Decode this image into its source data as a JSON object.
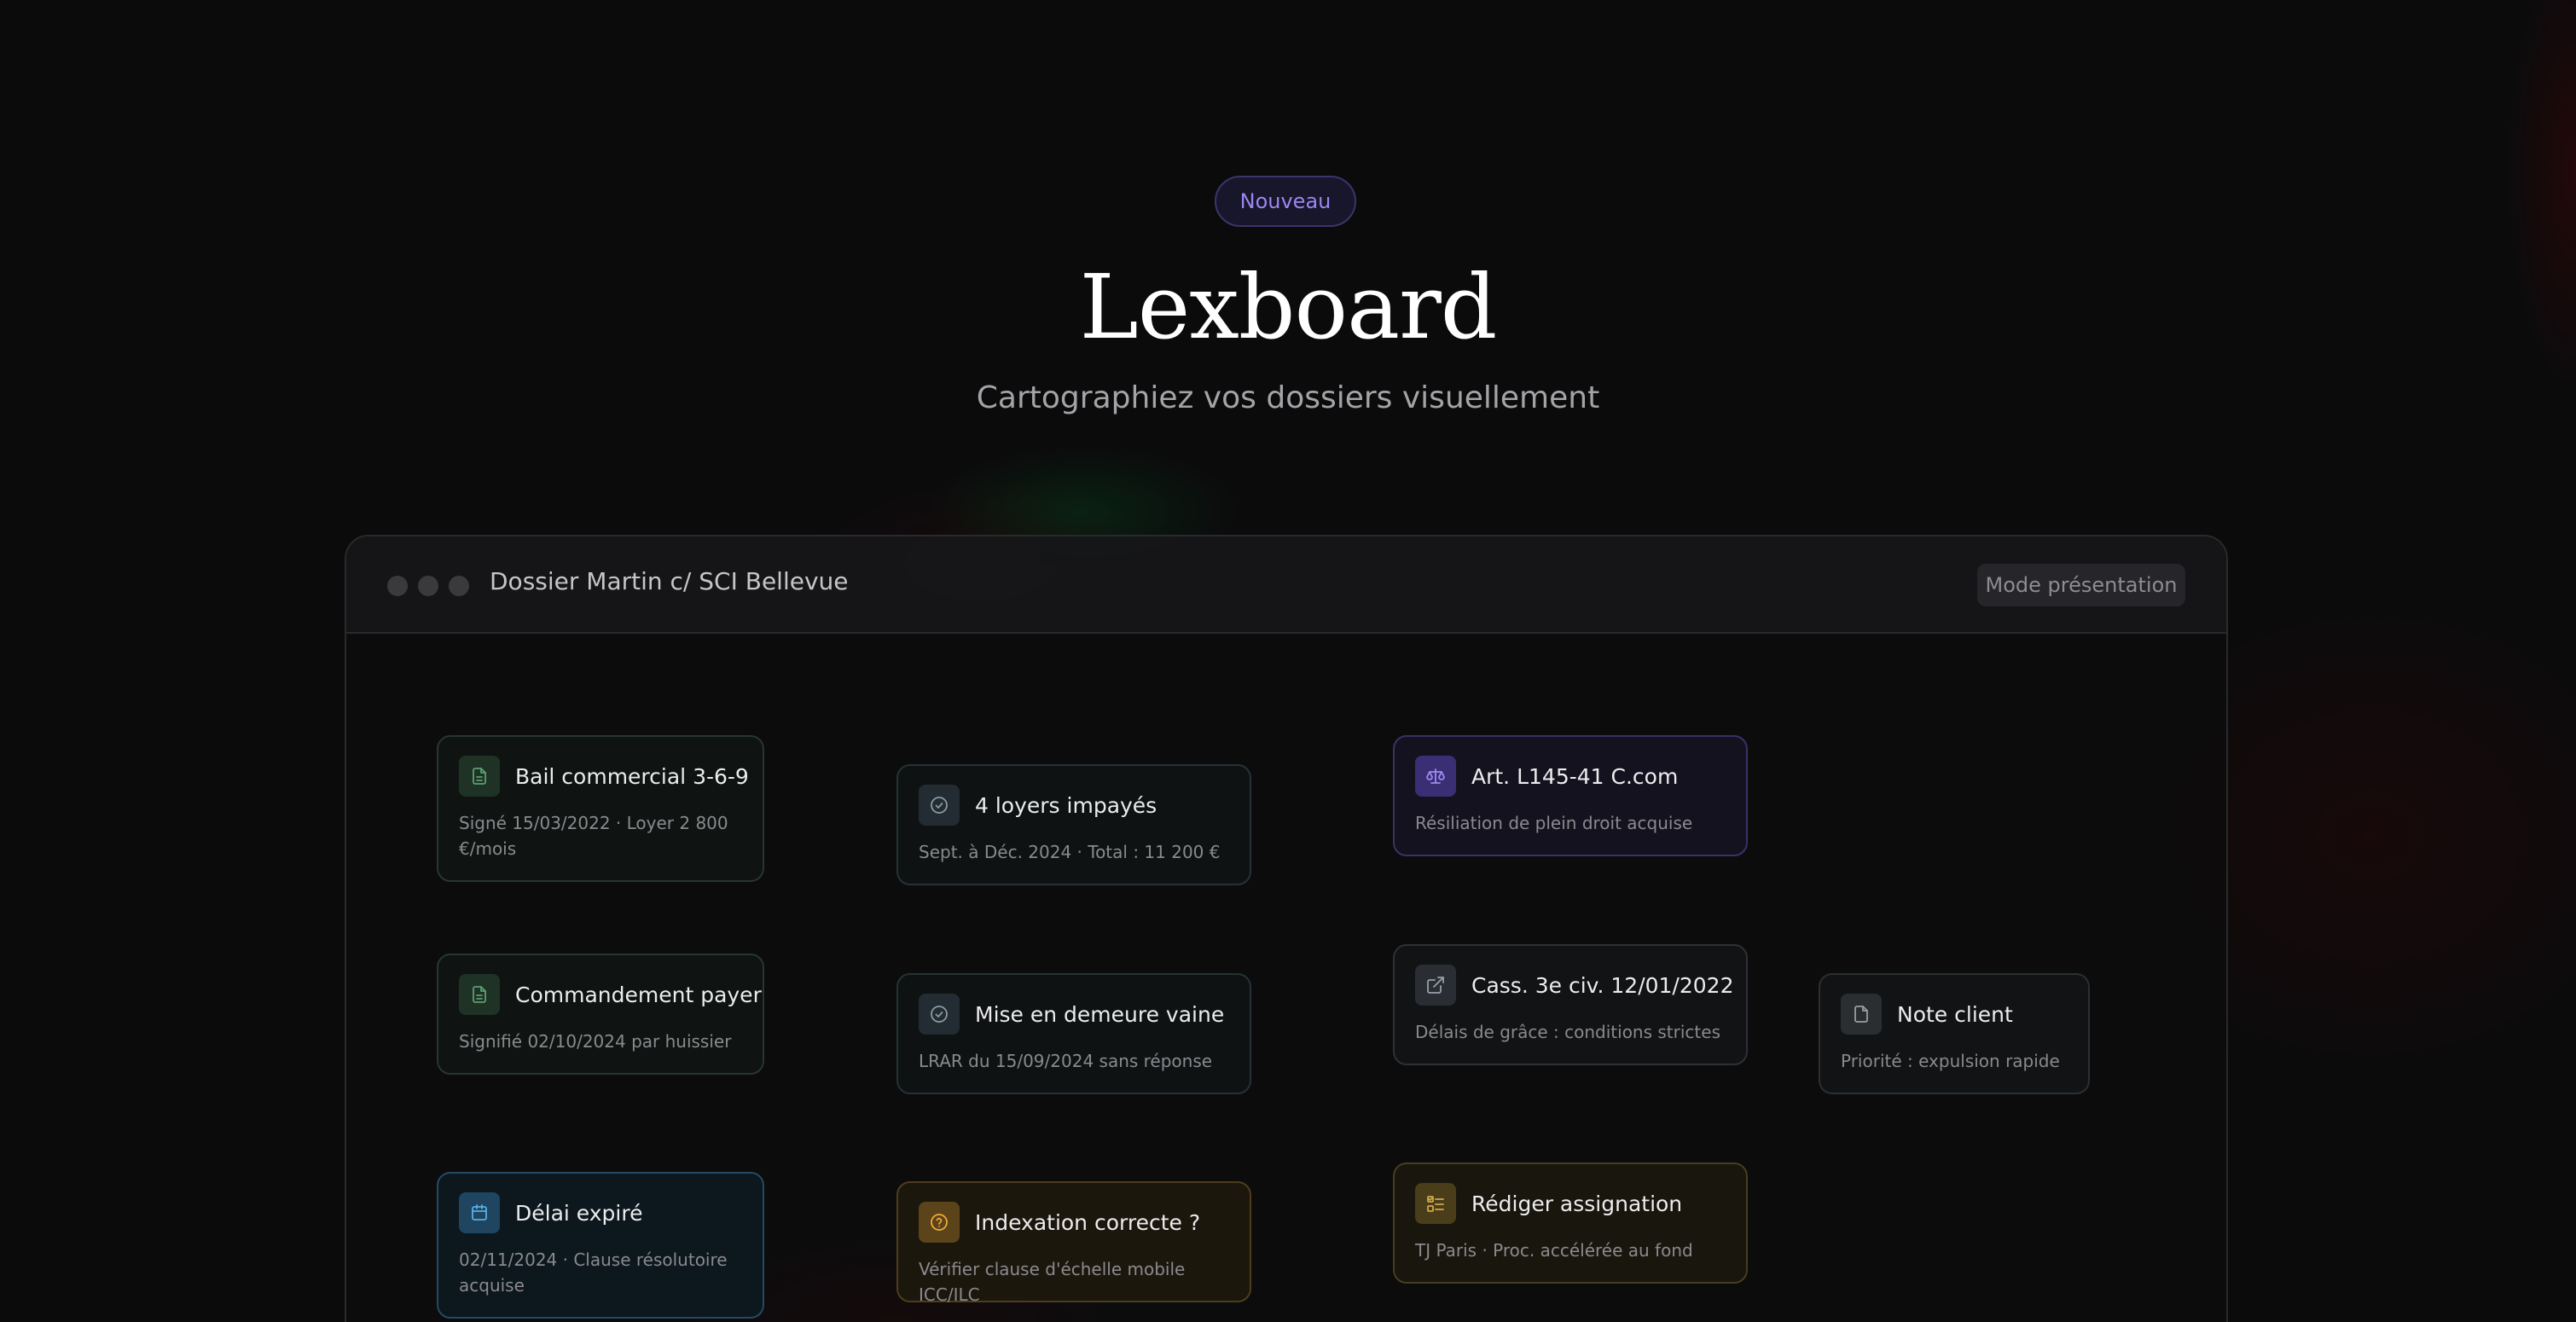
{
  "hero": {
    "badge": "Nouveau",
    "title": "Lexboard",
    "subtitle": "Cartographiez vos dossiers visuellement"
  },
  "window": {
    "title": "Dossier Martin c/ SCI Bellevue",
    "mode_button": "Mode présentation"
  },
  "nodes": [
    {
      "id": "bail",
      "icon": "document-icon",
      "title": "Bail commercial 3-6-9",
      "desc": "Signé 15/03/2022 · Loyer 2 800 €/mois"
    },
    {
      "id": "loyers",
      "icon": "check-circle-icon",
      "title": "4 loyers impayés",
      "desc": "Sept. à Déc. 2024 · Total : 11 200 €"
    },
    {
      "id": "article",
      "icon": "scales-icon",
      "title": "Art. L145-41 C.com",
      "desc": "Résiliation de plein droit acquise"
    },
    {
      "id": "commandement",
      "icon": "document-icon",
      "title": "Commandement payer",
      "desc": "Signifié 02/10/2024 par huissier"
    },
    {
      "id": "mise-en-demeure",
      "icon": "check-circle-icon",
      "title": "Mise en demeure vaine",
      "desc": "LRAR du 15/09/2024 sans réponse"
    },
    {
      "id": "cassation",
      "icon": "external-link-icon",
      "title": "Cass. 3e civ. 12/01/2022",
      "desc": "Délais de grâce : conditions strictes"
    },
    {
      "id": "note",
      "icon": "note-icon",
      "title": "Note client",
      "desc": "Priorité : expulsion rapide"
    },
    {
      "id": "delai",
      "icon": "calendar-icon",
      "title": "Délai expiré",
      "desc": "02/11/2024 · Clause résolutoire acquise"
    },
    {
      "id": "indexation",
      "icon": "question-circle-icon",
      "title": "Indexation correcte ?",
      "desc": "Vérifier clause d'échelle mobile ICC/ILC"
    },
    {
      "id": "assignation",
      "icon": "checklist-icon",
      "title": "Rédiger assignation",
      "desc": "TJ Paris · Proc. accélérée au fond"
    }
  ],
  "colors": {
    "accent": "#9b86ee",
    "background": "#0b0b0c",
    "doc": "#5e9e72",
    "check": "#8a9aa4",
    "law": "#a08af0",
    "calendar": "#5aaee6",
    "question": "#f0a838",
    "task": "#d2a84c"
  }
}
